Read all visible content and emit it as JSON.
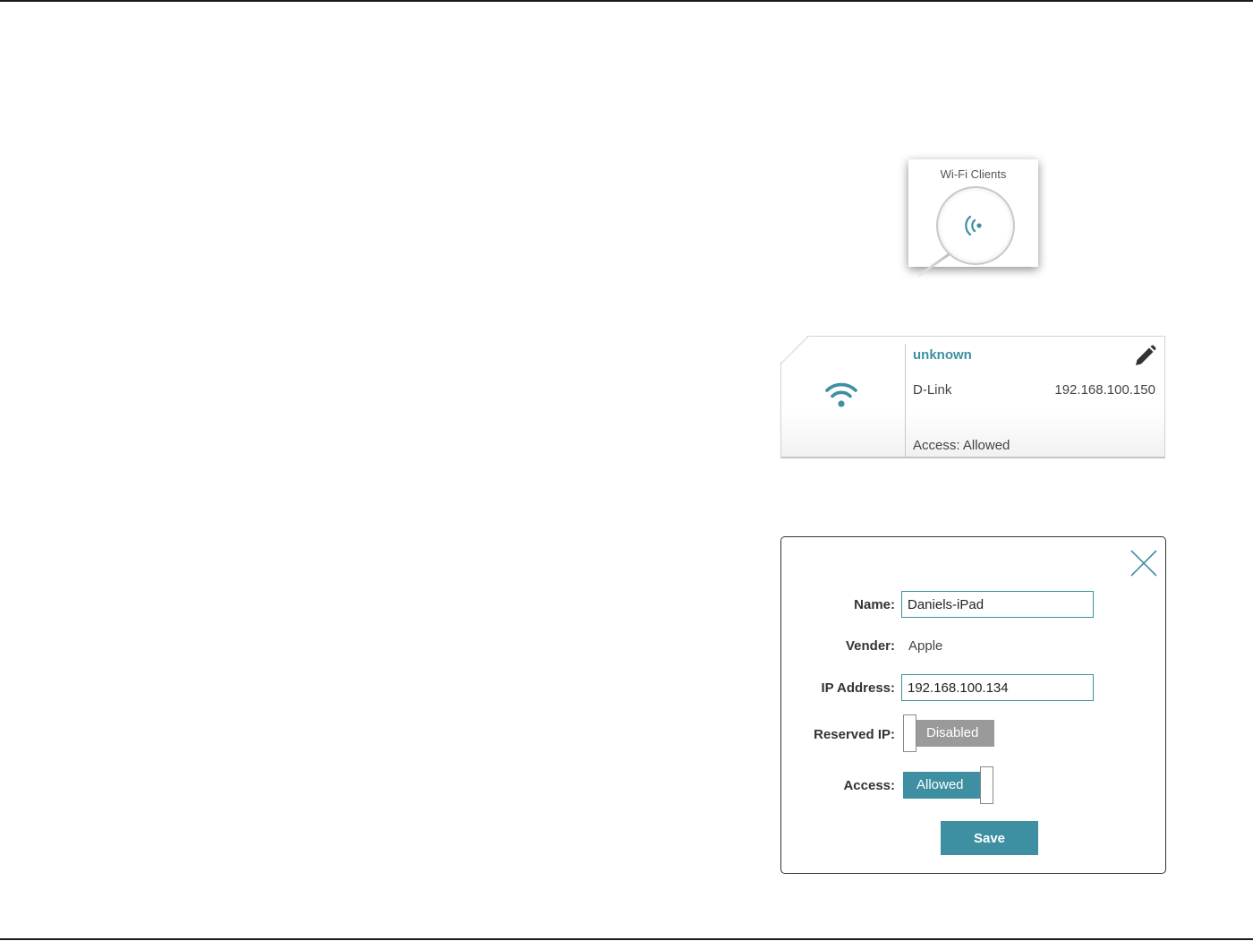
{
  "wifi_clients_tile": {
    "label": "Wi-Fi Clients",
    "icon": "wifi-signal-icon"
  },
  "client_card": {
    "name": "unknown",
    "vendor": "D-Link",
    "ip": "192.168.100.150",
    "access": "Access: Allowed",
    "icons": {
      "device": "wifi-icon",
      "edit": "pencil-icon"
    }
  },
  "edit_dialog": {
    "name_label": "Name:",
    "name_value": "Daniels-iPad",
    "vendor_label": "Vender:",
    "vendor_value": "Apple",
    "ip_label": "IP Address:",
    "ip_value": "192.168.100.134",
    "reserved_ip_label": "Reserved IP:",
    "reserved_ip_state": "Disabled",
    "access_label": "Access:",
    "access_state": "Allowed",
    "save_label": "Save",
    "close_icon": "close-icon"
  },
  "colors": {
    "accent": "#3d8fa1",
    "toggle_off": "#9a9a9a"
  }
}
